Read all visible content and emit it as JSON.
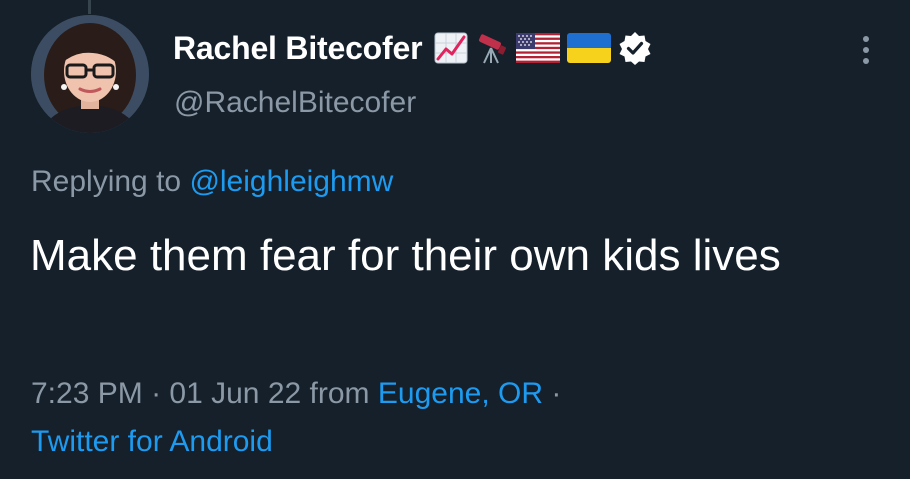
{
  "tweet": {
    "author": {
      "display_name": "Rachel Bitecofer",
      "handle": "@RachelBitecofer",
      "name_emojis": [
        "chart-increasing-icon",
        "telescope-icon",
        "us-flag-icon",
        "ukraine-flag-icon"
      ],
      "verified": true
    },
    "reply_context": {
      "prefix": "Replying to",
      "mention": "@leighleighmw"
    },
    "text": "Make them fear for their own kids lives",
    "meta": {
      "time": "7:23 PM",
      "sep1": "·",
      "date": "01 Jun 22",
      "from_label": "from",
      "location": "Eugene, OR",
      "sep2": "·",
      "source": "Twitter for Android"
    }
  },
  "colors": {
    "background": "#15202b",
    "primary_text": "#ffffff",
    "secondary_text": "#8b98a5",
    "link": "#1d9bf0"
  }
}
